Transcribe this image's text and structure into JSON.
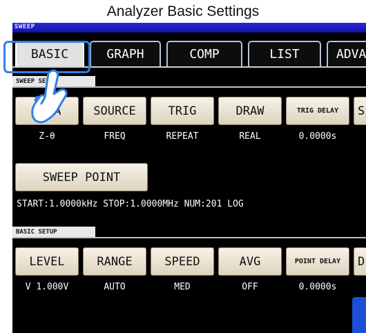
{
  "caption": "Analyzer Basic Settings",
  "mode_label": "SWEEP",
  "tabs": [
    {
      "label": "BASIC"
    },
    {
      "label": "GRAPH"
    },
    {
      "label": "COMP"
    },
    {
      "label": "LIST"
    },
    {
      "label": "ADVA"
    }
  ],
  "sweep_setup": {
    "section_label": "SWEEP SETUP",
    "buttons": [
      {
        "label": "PARA",
        "value": "Z-θ"
      },
      {
        "label": "SOURCE",
        "value": "FREQ"
      },
      {
        "label": "TRIG",
        "value": "REPEAT"
      },
      {
        "label": "DRAW",
        "value": "REAL"
      },
      {
        "label": "TRIG DELAY",
        "value": "0.0000s"
      },
      {
        "label": "S",
        "value": ""
      }
    ],
    "sweep_point_label": "SWEEP POINT",
    "info": "START:1.0000kHz STOP:1.0000MHz NUM:201 LOG"
  },
  "basic_setup": {
    "section_label": "BASIC SETUP",
    "buttons": [
      {
        "label": "LEVEL",
        "value": "V 1.000V"
      },
      {
        "label": "RANGE",
        "value": "AUTO"
      },
      {
        "label": "SPEED",
        "value": "MED"
      },
      {
        "label": "AVG",
        "value": "OFF"
      },
      {
        "label": "POINT DELAY",
        "value": "0.0000s"
      },
      {
        "label": "D",
        "value": ""
      }
    ]
  },
  "colors": {
    "mode_bar": "#1a1ac0",
    "highlight": "#2f7fe8",
    "button_face": "#ece5d4"
  }
}
